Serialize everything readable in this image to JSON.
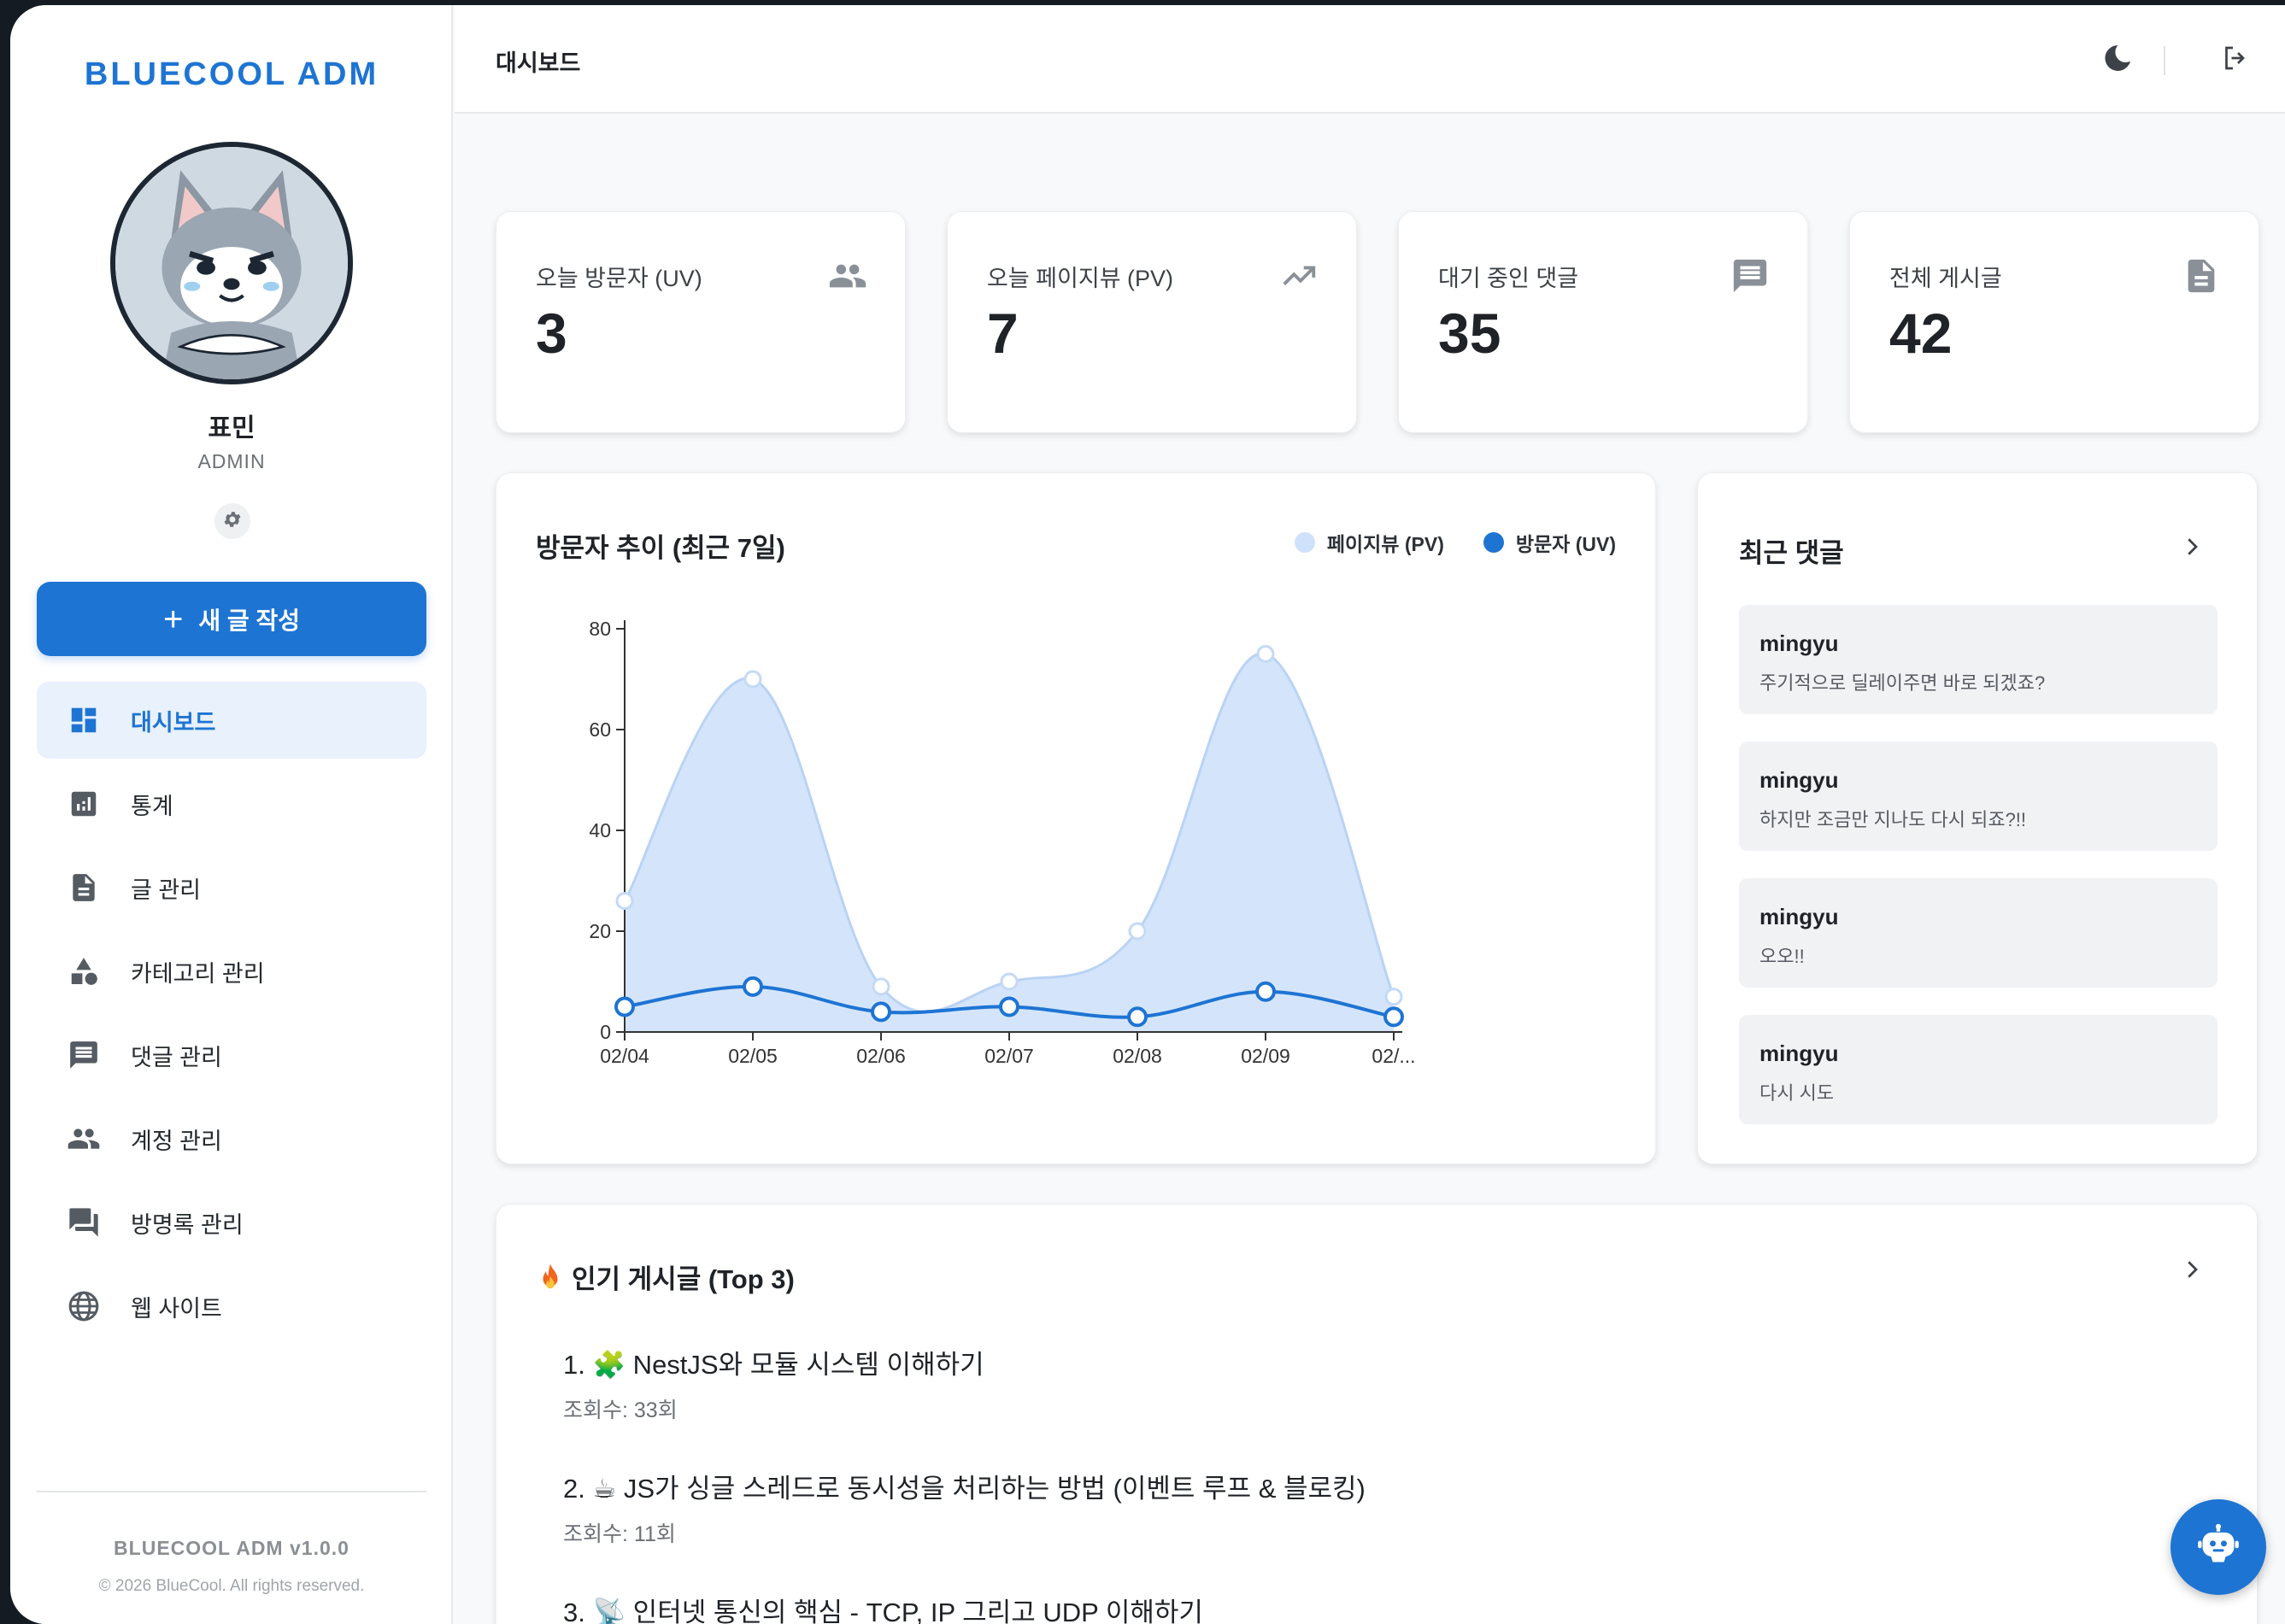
{
  "sidebar": {
    "brand": "BLUECOOL ADM",
    "user_name": "표민",
    "user_role": "ADMIN",
    "new_post_label": "새 글 작성",
    "items": [
      {
        "label": "대시보드",
        "icon": "dashboard-icon",
        "active": true
      },
      {
        "label": "통계",
        "icon": "analytics-icon"
      },
      {
        "label": "글 관리",
        "icon": "document-icon"
      },
      {
        "label": "카테고리 관리",
        "icon": "category-icon"
      },
      {
        "label": "댓글 관리",
        "icon": "comment-icon"
      },
      {
        "label": "계정 관리",
        "icon": "people-icon"
      },
      {
        "label": "방명록 관리",
        "icon": "forum-icon"
      },
      {
        "label": "웹 사이트",
        "icon": "globe-icon"
      }
    ],
    "version": "BLUECOOL ADM v1.0.0",
    "copyright": "© 2026 BlueCool. All rights reserved."
  },
  "header": {
    "title": "대시보드",
    "theme_icon": "moon-icon",
    "logout_icon": "logout-icon"
  },
  "stats": [
    {
      "label": "오늘 방문자 (UV)",
      "value": "3",
      "icon": "people-icon"
    },
    {
      "label": "오늘 페이지뷰 (PV)",
      "value": "7",
      "icon": "trending-up-icon"
    },
    {
      "label": "대기 중인 댓글",
      "value": "35",
      "icon": "comment-icon"
    },
    {
      "label": "전체 게시글",
      "value": "42",
      "icon": "document-icon"
    }
  ],
  "chart_card": {
    "title": "방문자 추이 (최근 7일)",
    "legend_pv": "페이지뷰 (PV)",
    "legend_uv": "방문자 (UV)"
  },
  "chart_data": {
    "type": "area",
    "categories": [
      "02/04",
      "02/05",
      "02/06",
      "02/07",
      "02/08",
      "02/09",
      "02/..."
    ],
    "series": [
      {
        "name": "페이지뷰 (PV)",
        "values": [
          26,
          70,
          9,
          10,
          20,
          75,
          7
        ],
        "color": "#cfe2fb"
      },
      {
        "name": "방문자 (UV)",
        "values": [
          5,
          9,
          4,
          5,
          3,
          8,
          3
        ],
        "color": "#1e74d3"
      }
    ],
    "yticks": [
      0,
      20,
      40,
      60,
      80
    ],
    "ylim": [
      0,
      80
    ],
    "grid": false
  },
  "comments": {
    "title": "최근 댓글",
    "items": [
      {
        "author": "mingyu",
        "text": "주기적으로 딜레이주면 바로 되겠죠?"
      },
      {
        "author": "mingyu",
        "text": "하지만 조금만 지나도 다시 되죠?!!"
      },
      {
        "author": "mingyu",
        "text": "오오!!"
      },
      {
        "author": "mingyu",
        "text": "다시 시도"
      }
    ]
  },
  "popular": {
    "title": "인기 게시글 (Top 3)",
    "posts": [
      {
        "title": "1. 🧩 NestJS와 모듈 시스템 이해하기",
        "views": "조회수: 33회"
      },
      {
        "title": "2. ☕ JS가 싱글 스레드로 동시성을 처리하는 방법 (이벤트 루프 & 블로킹)",
        "views": "조회수: 11회"
      },
      {
        "title": "3. 📡 인터넷 통신의 핵심 - TCP, IP 그리고 UDP 이해하기",
        "views": ""
      }
    ]
  },
  "colors": {
    "accent": "#1e74d3",
    "pv_fill": "#cfe2fb",
    "active_bg": "#e8f1fc"
  }
}
